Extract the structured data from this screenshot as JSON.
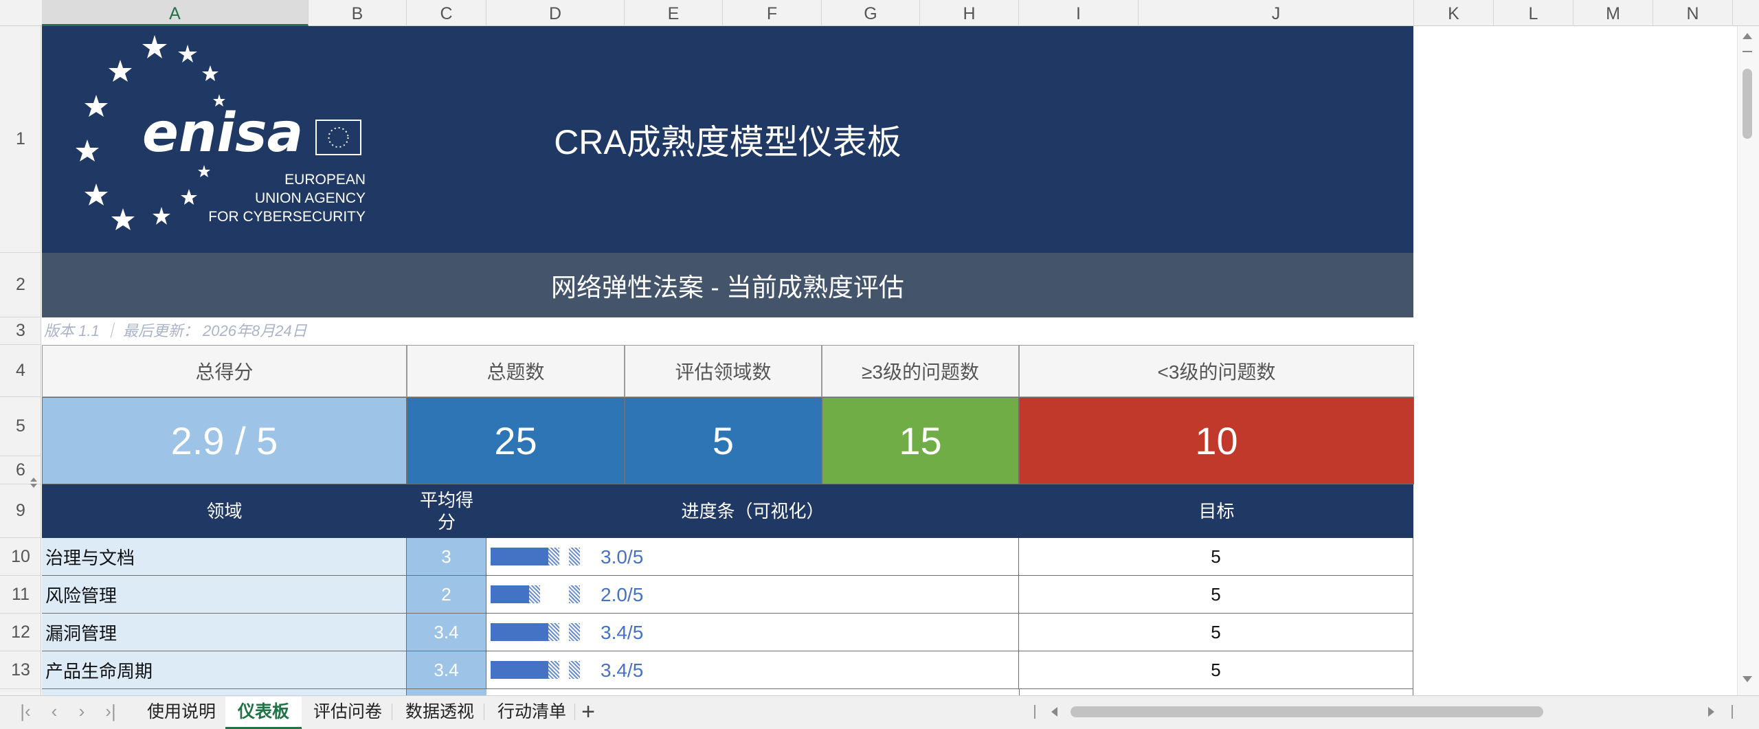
{
  "columns": [
    "A",
    "B",
    "C",
    "D",
    "E",
    "F",
    "G",
    "H",
    "I",
    "J",
    "K",
    "L",
    "M",
    "N"
  ],
  "rows": [
    "1",
    "2",
    "3",
    "4",
    "5",
    "6",
    "9",
    "10",
    "11",
    "12",
    "13"
  ],
  "logo": {
    "name": "enisa",
    "line1": "EUROPEAN",
    "line2": "UNION AGENCY",
    "line3": "FOR CYBERSECURITY"
  },
  "title": "CRA成熟度模型仪表板",
  "subtitle": "网络弹性法案 - 当前成熟度评估",
  "version_line": "版本 1.1 ｜ 最后更新： 2026年8月24日",
  "kpis": [
    {
      "label": "总得分",
      "value": "2.9 / 5",
      "color": "#9dc3e6"
    },
    {
      "label": "总题数",
      "value": "25",
      "color": "#2e75b6"
    },
    {
      "label": "评估领域数",
      "value": "5",
      "color": "#2e75b6"
    },
    {
      "label": "≥3级的问题数",
      "value": "15",
      "color": "#70ad47"
    },
    {
      "label": "<3级的问题数",
      "value": "10",
      "color": "#c0392b"
    }
  ],
  "table": {
    "headers": {
      "domain": "领域",
      "avg": "平均得分",
      "progress": "进度条（可视化）",
      "target": "目标"
    },
    "rows": [
      {
        "domain": "治理与文档",
        "score": "3",
        "score_value": 3.0,
        "progress_text": "3.0/5",
        "target": "5"
      },
      {
        "domain": "风险管理",
        "score": "2",
        "score_value": 2.0,
        "progress_text": "2.0/5",
        "target": "5"
      },
      {
        "domain": "漏洞管理",
        "score": "3.4",
        "score_value": 3.4,
        "progress_text": "3.4/5",
        "target": "5"
      },
      {
        "domain": "产品生命周期",
        "score": "3.4",
        "score_value": 3.4,
        "progress_text": "3.4/5",
        "target": "5"
      }
    ]
  },
  "sheet_tabs": [
    "使用说明",
    "仪表板",
    "评估问卷",
    "数据透视",
    "行动清单"
  ],
  "active_tab": "仪表板",
  "colors": {
    "banner": "#203864",
    "subbanner": "#44546a",
    "accent": "#217346",
    "bar": "#4472c4"
  },
  "icons": {
    "add_sheet": "plus-icon",
    "nav_first": "first-sheet-icon",
    "nav_prev": "prev-sheet-icon",
    "nav_next": "next-sheet-icon",
    "nav_last": "last-sheet-icon"
  }
}
